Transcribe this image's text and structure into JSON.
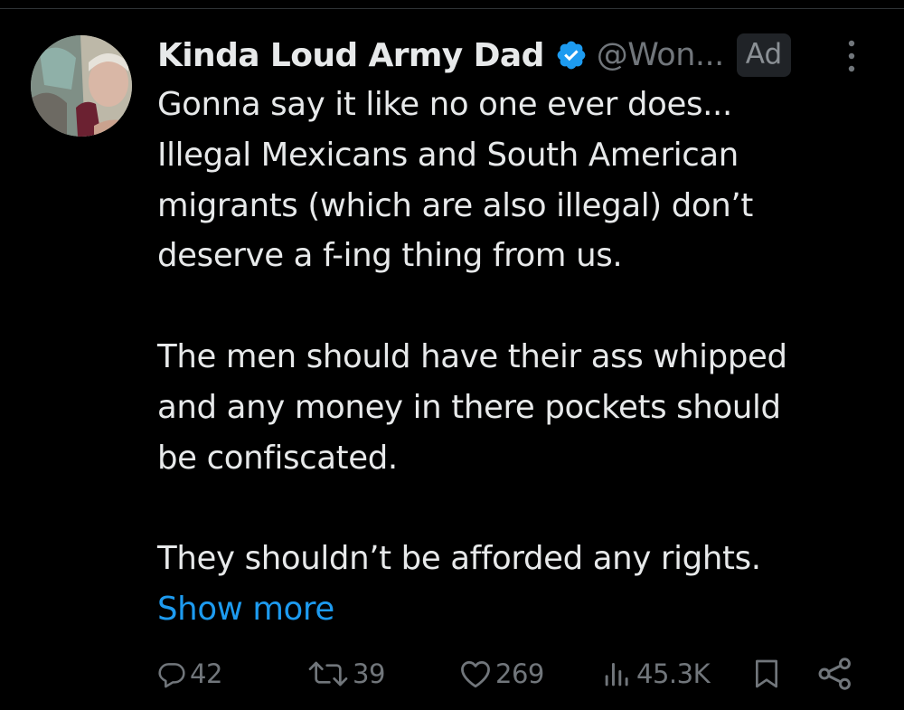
{
  "post": {
    "author": {
      "display_name": "Kinda Loud Army Dad",
      "handle": "@Won...",
      "verified_icon": "verified-badge-icon",
      "avatar_icon": "avatar"
    },
    "ad_label": "Ad",
    "more_icon": "more-vertical-icon",
    "text_lines": [
      "Gonna say it like no one ever does...",
      "Illegal Mexicans and South American",
      "migrants (which are also illegal) don’t",
      "deserve a f-ing thing from us.",
      "",
      "The men should have their ass whipped",
      "and any money in there pockets should",
      "be confiscated.",
      "",
      "They shouldn’t be afforded any rights."
    ],
    "show_more_label": "Show more"
  },
  "actions": {
    "reply": {
      "icon": "reply-icon",
      "count": "42"
    },
    "repost": {
      "icon": "repost-icon",
      "count": "39"
    },
    "like": {
      "icon": "heart-icon",
      "count": "269"
    },
    "views": {
      "icon": "views-icon",
      "count": "45.3K"
    },
    "bookmark": {
      "icon": "bookmark-icon"
    },
    "share": {
      "icon": "share-icon"
    }
  },
  "colors": {
    "background": "#000000",
    "primary_text": "#e7e9ea",
    "secondary_text": "#71767b",
    "accent": "#1d9bf0",
    "ad_badge_bg": "#202327"
  }
}
